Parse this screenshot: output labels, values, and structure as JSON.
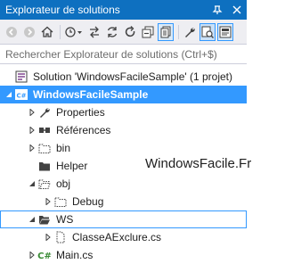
{
  "window": {
    "title": "Explorateur de solutions",
    "pin_icon": "pin-icon",
    "close_icon": "close-icon"
  },
  "toolbar": {
    "buttons": [
      "back-icon",
      "forward-icon",
      "home-icon",
      "history-dropdown-icon",
      "pending-changes-icon",
      "sync-icon",
      "refresh-icon",
      "collapse-all-icon",
      "show-all-files-icon",
      "properties-icon",
      "view-code-icon",
      "preview-icon"
    ]
  },
  "search": {
    "placeholder": "Rechercher Explorateur de solutions (Ctrl+$)"
  },
  "tree": {
    "solution": "Solution 'WindowsFacileSample' (1 projet)",
    "project": "WindowsFacileSample",
    "properties": "Properties",
    "references": "Références",
    "bin": "bin",
    "helper": "Helper",
    "obj": "obj",
    "debug": "Debug",
    "ws": "WS",
    "classe": "ClasseAExclure.cs",
    "main": "Main.cs"
  },
  "watermark": "WindowsFacile.Fr",
  "colors": {
    "title_bar": "#0e70c0",
    "selection": "#3399ff",
    "toolbar": "#eeeef2"
  }
}
